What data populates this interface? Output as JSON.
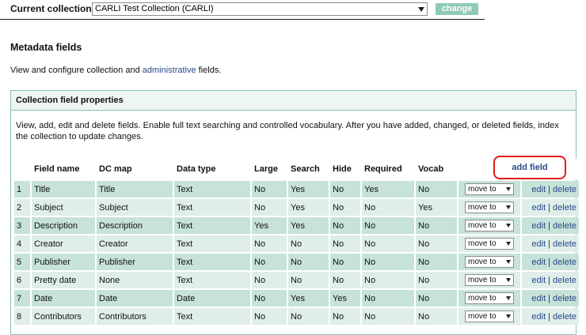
{
  "topbar": {
    "collection_label": "Current collection:",
    "collection_value": "CARLI Test Collection (CARLI)",
    "change_label": "change"
  },
  "page": {
    "heading": "Metadata fields",
    "intro_before": "View and configure collection and ",
    "intro_link": "administrative",
    "intro_after": " fields."
  },
  "panel": {
    "title": "Collection field properties",
    "description": "View, add, edit and delete fields. Enable full text searching and controlled vocabulary. After you have added, changed, or deleted fields, index the collection to update changes.",
    "add_field_label": "add field"
  },
  "table": {
    "headers": [
      "",
      "Field name",
      "DC map",
      "Data type",
      "Large",
      "Search",
      "Hide",
      "Required",
      "Vocab",
      "",
      ""
    ],
    "move_label": "move to",
    "edit_label": "edit",
    "delete_label": "delete",
    "separator": "|",
    "rows": [
      {
        "num": "1",
        "name": "Title",
        "dc": "Title",
        "type": "Text",
        "large": "No",
        "search": "Yes",
        "hide": "No",
        "required": "Yes",
        "vocab": "No"
      },
      {
        "num": "2",
        "name": "Subject",
        "dc": "Subject",
        "type": "Text",
        "large": "No",
        "search": "Yes",
        "hide": "No",
        "required": "No",
        "vocab": "Yes"
      },
      {
        "num": "3",
        "name": "Description",
        "dc": "Description",
        "type": "Text",
        "large": "Yes",
        "search": "Yes",
        "hide": "No",
        "required": "No",
        "vocab": "No"
      },
      {
        "num": "4",
        "name": "Creator",
        "dc": "Creator",
        "type": "Text",
        "large": "No",
        "search": "No",
        "hide": "No",
        "required": "No",
        "vocab": "No"
      },
      {
        "num": "5",
        "name": "Publisher",
        "dc": "Publisher",
        "type": "Text",
        "large": "No",
        "search": "No",
        "hide": "No",
        "required": "No",
        "vocab": "No"
      },
      {
        "num": "6",
        "name": "Pretty date",
        "dc": "None",
        "type": "Text",
        "large": "No",
        "search": "No",
        "hide": "No",
        "required": "No",
        "vocab": "No"
      },
      {
        "num": "7",
        "name": "Date",
        "dc": "Date",
        "type": "Date",
        "large": "No",
        "search": "Yes",
        "hide": "Yes",
        "required": "No",
        "vocab": "No"
      },
      {
        "num": "8",
        "name": "Contributors",
        "dc": "Contributors",
        "type": "Text",
        "large": "No",
        "search": "No",
        "hide": "No",
        "required": "No",
        "vocab": "No"
      }
    ]
  },
  "colors": {
    "accent": "#8fcab8",
    "row_dark": "#c6e2d9",
    "row_light": "#dfeeea",
    "border": "#86c2ad",
    "link": "#2a4a8a",
    "highlight": "#e21a1a"
  }
}
